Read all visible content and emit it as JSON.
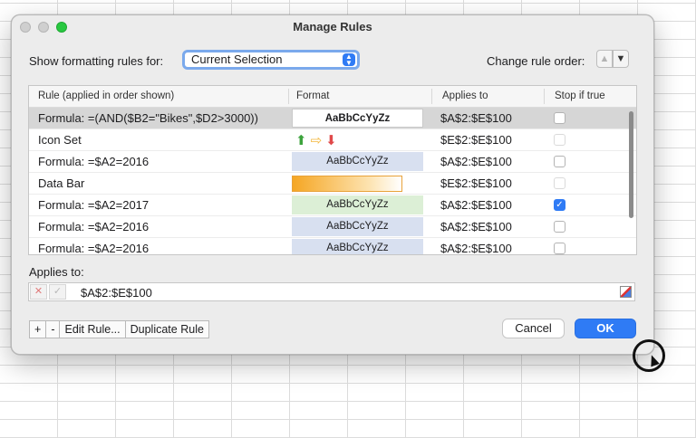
{
  "window": {
    "title": "Manage Rules"
  },
  "show_rules": {
    "label": "Show formatting rules for:",
    "selected": "Current Selection"
  },
  "rule_order": {
    "label": "Change rule order:"
  },
  "table": {
    "headers": [
      "Rule (applied in order shown)",
      "Format",
      "Applies to",
      "Stop if true"
    ],
    "rows": [
      {
        "rule": "Formula: =(AND($B2=\"Bikes\",$D2>3000))",
        "format_type": "text-white",
        "format_text": "AaBbCcYyZz",
        "applies": "$A$2:$E$100",
        "stop": "unchecked",
        "selected": true
      },
      {
        "rule": "Icon Set",
        "format_type": "icons",
        "format_text": "",
        "applies": "$E$2:$E$100",
        "stop": "disabled"
      },
      {
        "rule": "Formula: =$A2=2016",
        "format_type": "text-blue",
        "format_text": "AaBbCcYyZz",
        "applies": "$A$2:$E$100",
        "stop": "unchecked"
      },
      {
        "rule": "Data Bar",
        "format_type": "databar",
        "format_text": "",
        "applies": "$E$2:$E$100",
        "stop": "disabled"
      },
      {
        "rule": "Formula: =$A2=2017",
        "format_type": "text-green",
        "format_text": "AaBbCcYyZz",
        "applies": "$A$2:$E$100",
        "stop": "checked"
      },
      {
        "rule": "Formula: =$A2=2016",
        "format_type": "text-blue",
        "format_text": "AaBbCcYyZz",
        "applies": "$A$2:$E$100",
        "stop": "unchecked"
      },
      {
        "rule": "Formula: =$A2=2016",
        "format_type": "text-blue",
        "format_text": "AaBbCcYyZz",
        "applies": "$A$2:$E$100",
        "stop": "unchecked"
      }
    ]
  },
  "applies_to": {
    "label": "Applies to:",
    "value": "$A$2:$E$100"
  },
  "buttons": {
    "add": "+",
    "remove": "-",
    "edit": "Edit Rule...",
    "duplicate": "Duplicate Rule",
    "cancel": "Cancel",
    "ok": "OK"
  },
  "colors": {
    "accent": "#2f7bf5",
    "selected_row": "#d6d6d6",
    "format_blue": "#d8e0f0",
    "format_green": "#dcefd6"
  }
}
